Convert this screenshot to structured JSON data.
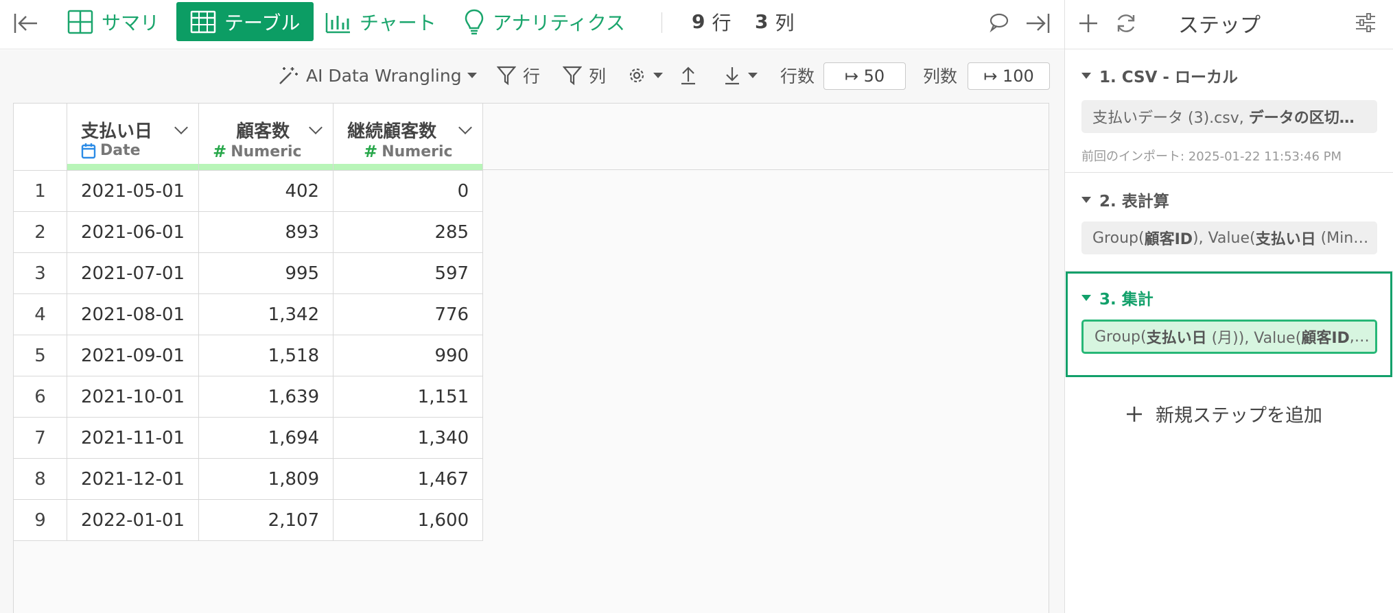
{
  "topbar": {
    "tabs": [
      {
        "label": "サマリ"
      },
      {
        "label": "テーブル"
      },
      {
        "label": "チャート"
      },
      {
        "label": "アナリティクス"
      }
    ],
    "row_count": "9",
    "row_unit": "行",
    "col_count": "3",
    "col_unit": "列"
  },
  "toolbar": {
    "ai_label": "AI Data Wrangling",
    "filter_row": "行",
    "filter_col": "列",
    "rows_label": "行数",
    "rows_value": "↦ 50",
    "cols_label": "列数",
    "cols_value": "↦ 100"
  },
  "table": {
    "columns": [
      {
        "name": "支払い日",
        "type": "Date"
      },
      {
        "name": "顧客数",
        "type": "Numeric"
      },
      {
        "name": "継続顧客数",
        "type": "Numeric"
      }
    ],
    "rows": [
      {
        "idx": "1",
        "date": "2021-05-01",
        "customers": "402",
        "retained": "0"
      },
      {
        "idx": "2",
        "date": "2021-06-01",
        "customers": "893",
        "retained": "285"
      },
      {
        "idx": "3",
        "date": "2021-07-01",
        "customers": "995",
        "retained": "597"
      },
      {
        "idx": "4",
        "date": "2021-08-01",
        "customers": "1,342",
        "retained": "776"
      },
      {
        "idx": "5",
        "date": "2021-09-01",
        "customers": "1,518",
        "retained": "990"
      },
      {
        "idx": "6",
        "date": "2021-10-01",
        "customers": "1,639",
        "retained": "1,151"
      },
      {
        "idx": "7",
        "date": "2021-11-01",
        "customers": "1,694",
        "retained": "1,340"
      },
      {
        "idx": "8",
        "date": "2021-12-01",
        "customers": "1,809",
        "retained": "1,467"
      },
      {
        "idx": "9",
        "date": "2022-01-01",
        "customers": "2,107",
        "retained": "1,600"
      }
    ]
  },
  "panel": {
    "title": "ステップ",
    "steps": [
      {
        "title": "1. CSV - ローカル",
        "body_plain": "支払いデータ (3).csv, ",
        "body_bold": "データの区切…",
        "meta": "前回のインポート: 2025-01-22 11:53:46 PM"
      },
      {
        "title": "2. 表計算",
        "body_parts": [
          "Group(",
          "顧客ID",
          "), Value(",
          "支払い日",
          " (Min…"
        ]
      },
      {
        "title": "3. 集計",
        "body_parts": [
          "Group(",
          "支払い日",
          " (月)), Value(",
          "顧客ID",
          ",…"
        ]
      }
    ],
    "add_step": "新規ステップを追加"
  },
  "colors": {
    "accent": "#0c9d64",
    "accent_text": "#1aa56c",
    "active_border": "#12a06a",
    "numeric_hash": "#27a74a",
    "header_bar": "#b8f5b8"
  }
}
